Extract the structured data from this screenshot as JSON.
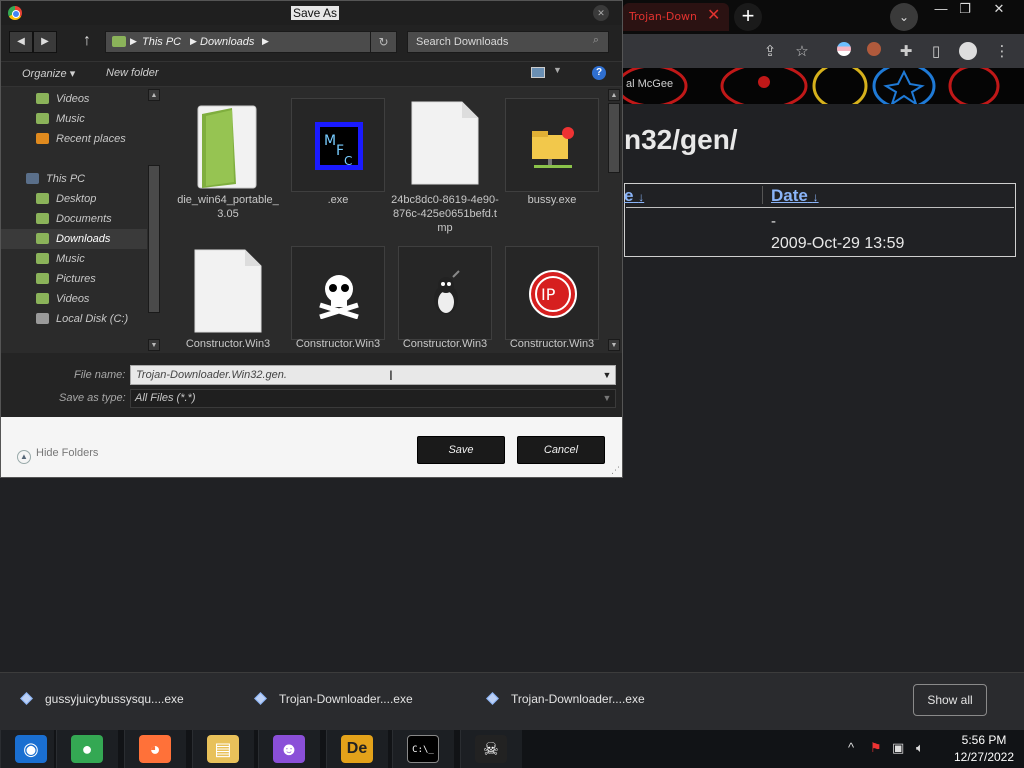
{
  "browser": {
    "tab_title": "Trojan-Down",
    "tab_close": "✕",
    "new_tab": "+",
    "minimize": "—",
    "restore": "❐",
    "close": "✕",
    "bookmark_text": "al McGee",
    "page_heading": "n32/gen/",
    "table": {
      "col_name": "e",
      "col_date": "Date",
      "sort_glyph": "↓",
      "row1_date": "-",
      "row2_date": "2009-Oct-29 13:59"
    }
  },
  "downloads": {
    "items": [
      {
        "label": "gussyjuicybussysqu....exe"
      },
      {
        "label": "Trojan-Downloader....exe"
      },
      {
        "label": "Trojan-Downloader....exe"
      }
    ],
    "show_all": "Show all"
  },
  "taskbar": {
    "apps": [
      {
        "name": "start-button",
        "glyph": "◉",
        "color": "#1a6fd1"
      },
      {
        "name": "chrome",
        "glyph": "●",
        "color": "#34a853"
      },
      {
        "name": "firefox",
        "glyph": "◕",
        "color": "#ff7139"
      },
      {
        "name": "file-explorer",
        "glyph": "▤",
        "color": "#e8c15a"
      },
      {
        "name": "people-app",
        "glyph": "☻",
        "color": "#8a4fd8"
      },
      {
        "name": "de-app",
        "glyph": "De",
        "color": "#e3a21a"
      },
      {
        "name": "command-prompt",
        "glyph": "C:\\_",
        "color": "#000000"
      },
      {
        "name": "skull-app",
        "glyph": "☠",
        "color": "#222222"
      }
    ],
    "tray_chevron": "^",
    "clock_time": "5:56 PM",
    "clock_date": "12/27/2022"
  },
  "dialog": {
    "title": "Save As",
    "close_glyph": "✕",
    "back_glyph": "◀",
    "forward_glyph": "▶",
    "up_glyph": "↑",
    "breadcrumb": {
      "this_pc": "This PC",
      "downloads": "Downloads",
      "sep": "▶"
    },
    "refresh_glyph": "↻",
    "search_placeholder": "Search Downloads",
    "search_glyph": "⌕",
    "organize": "Organize ▾",
    "new_folder": "New folder",
    "view_dd": "▼",
    "help_glyph": "?",
    "nav_items": [
      {
        "label": "Videos",
        "color": "#8bb35a",
        "selected": false
      },
      {
        "label": "Music",
        "color": "#8bb35a",
        "selected": false
      },
      {
        "label": "Recent places",
        "color": "#e08a1e",
        "selected": false
      },
      {
        "label": "",
        "color": "",
        "selected": false
      },
      {
        "label": "This PC",
        "color": "#5a6f8a",
        "selected": false
      },
      {
        "label": "Desktop",
        "color": "#8bb35a",
        "selected": false
      },
      {
        "label": "Documents",
        "color": "#8bb35a",
        "selected": false
      },
      {
        "label": "Downloads",
        "color": "#8bb35a",
        "selected": true
      },
      {
        "label": "Music",
        "color": "#8bb35a",
        "selected": false
      },
      {
        "label": "Pictures",
        "color": "#8bb35a",
        "selected": false
      },
      {
        "label": "Videos",
        "color": "#8bb35a",
        "selected": false
      },
      {
        "label": "Local Disk (C:)",
        "color": "#9a9a9a",
        "selected": false
      }
    ],
    "scroll_up": "▲",
    "scroll_down": "▼",
    "files": [
      {
        "label": "die_win64_portable_3.05",
        "icon": "green-folder-icon"
      },
      {
        "label": ".exe",
        "icon": "mfc-app-icon"
      },
      {
        "label": "24bc8dc0-8619-4e90-876c-425e0651befd.tmp",
        "icon": "blank-file-icon"
      },
      {
        "label": "bussy.exe",
        "icon": "network-folder-icon"
      },
      {
        "label": "Constructor.Win3",
        "icon": "blank-file-icon"
      },
      {
        "label": "Constructor.Win3",
        "icon": "skull-icon"
      },
      {
        "label": "Constructor.Win3",
        "icon": "penguin-bomb-icon"
      },
      {
        "label": "Constructor.Win3",
        "icon": "ip-badge-icon"
      }
    ],
    "ip_text": "IP",
    "file_name_label": "File name:",
    "file_name_value": "Trojan-Downloader.Win32.gen.",
    "save_type_label": "Save as type:",
    "save_type_value": "All Files (*.*)",
    "dd_glyph": "▼",
    "caret_glyph": "I",
    "hide_folders": "Hide Folders",
    "hide_folders_glyph": "▲",
    "save_button": "Save",
    "cancel_button": "Cancel",
    "grip": "⋰"
  }
}
